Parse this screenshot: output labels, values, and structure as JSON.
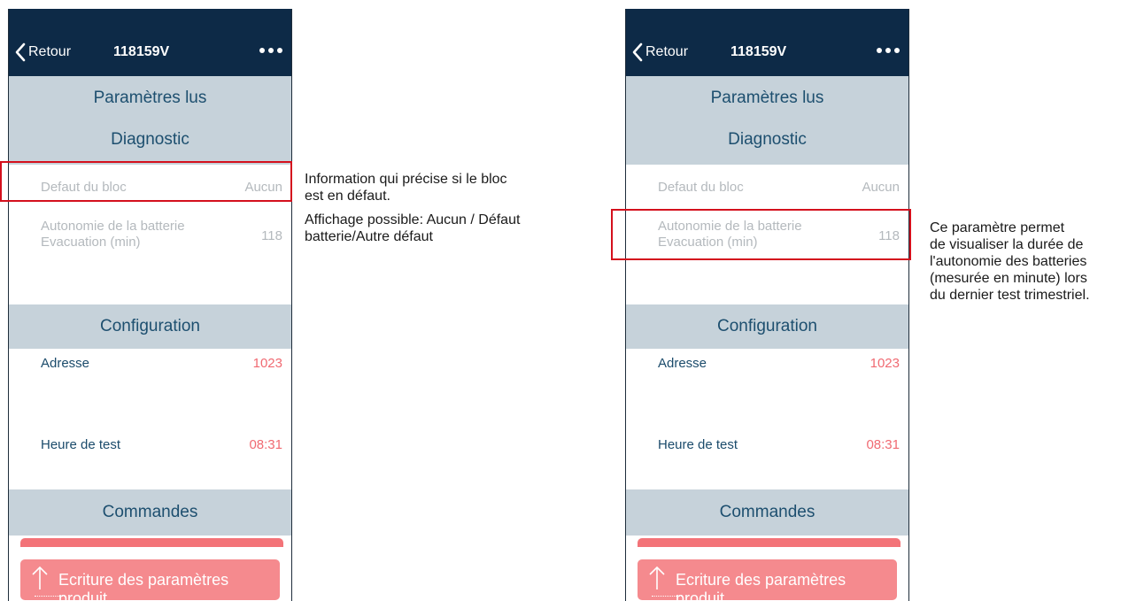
{
  "screens": [
    {
      "nav": {
        "back_label": "Retour",
        "title": "118159V"
      },
      "sections": {
        "read_params": "Paramètres lus",
        "diagnostic": "Diagnostic",
        "configuration": "Configuration",
        "commands": "Commandes"
      },
      "diagnostic_rows": [
        {
          "label": "Defaut du bloc",
          "value": "Aucun"
        },
        {
          "label_line1": "Autonomie de la batterie",
          "label_line2": "Evacuation (min)",
          "value": "118"
        }
      ],
      "config_rows": [
        {
          "label": "Adresse",
          "value": "1023"
        },
        {
          "label": "Heure de test",
          "value": "08:31"
        }
      ],
      "action_button": "Ecriture des paramètres produit"
    },
    {
      "nav": {
        "back_label": "Retour",
        "title": "118159V"
      },
      "sections": {
        "read_params": "Paramètres lus",
        "diagnostic": "Diagnostic",
        "configuration": "Configuration",
        "commands": "Commandes"
      },
      "diagnostic_rows": [
        {
          "label": "Defaut du bloc",
          "value": "Aucun"
        },
        {
          "label_line1": "Autonomie de la batterie",
          "label_line2": "Evacuation (min)",
          "value": "118"
        }
      ],
      "config_rows": [
        {
          "label": "Adresse",
          "value": "1023"
        },
        {
          "label": "Heure de test",
          "value": "08:31"
        }
      ],
      "action_button": "Ecriture des paramètres produit"
    }
  ],
  "annotations": {
    "left": {
      "line1": "Information qui précise si le bloc",
      "line2": "est en défaut.",
      "line3": "Affichage possible:  Aucun / Défaut",
      "line4": "batterie/Autre défaut"
    },
    "right": {
      "line1": "Ce paramètre permet",
      "line2": "de visualiser la durée de",
      "line3": "l'autonomie des batteries",
      "line4": "(mesurée en minute) lors",
      "line5": "du dernier test trimestriel."
    }
  },
  "colors": {
    "navbar": "#0d2a47",
    "section_header": "#c6d2da",
    "section_text": "#1d4f6f",
    "value_red": "#f06a72",
    "action_button": "#f58a8e",
    "highlight": "#d4101d"
  },
  "icons": {
    "back": "chevron-left-icon",
    "more": "more-dots-icon",
    "upload": "arrow-up-icon"
  }
}
